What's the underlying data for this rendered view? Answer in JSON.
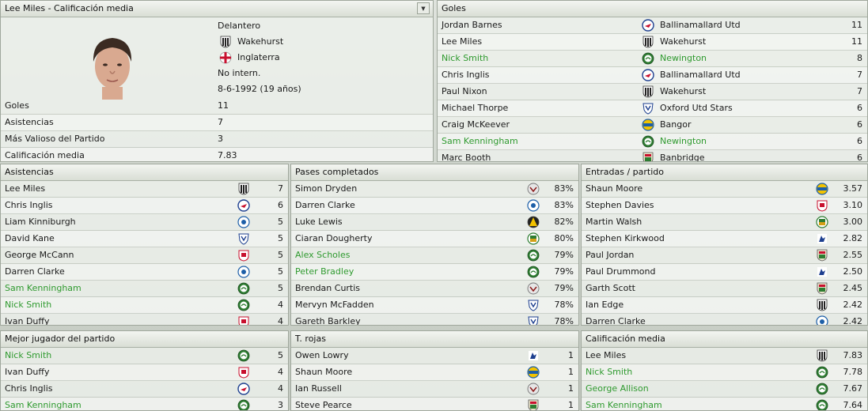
{
  "profile": {
    "title": "Lee Miles - Calificación media",
    "position": "Delantero",
    "club": "Wakehurst",
    "nation": "Inglaterra",
    "international": "No intern.",
    "dob": "8-6-1992 (19 años)",
    "stats": [
      {
        "label": "Goles",
        "value": "11"
      },
      {
        "label": "Asistencias",
        "value": "7"
      },
      {
        "label": "Más Valioso del Partido",
        "value": "3"
      },
      {
        "label": "Calificación media",
        "value": "7.83"
      }
    ]
  },
  "goals": {
    "title": "Goles",
    "rows": [
      {
        "name": "Jordan Barnes",
        "club": "Ballinamallard Utd",
        "value": "11",
        "hl": false,
        "badge": "ballinamallard"
      },
      {
        "name": "Lee Miles",
        "club": "Wakehurst",
        "value": "11",
        "hl": false,
        "badge": "wakehurst"
      },
      {
        "name": "Nick Smith",
        "club": "Newington",
        "value": "8",
        "hl": true,
        "badge": "newington"
      },
      {
        "name": "Chris Inglis",
        "club": "Ballinamallard Utd",
        "value": "7",
        "hl": false,
        "badge": "ballinamallard"
      },
      {
        "name": "Paul Nixon",
        "club": "Wakehurst",
        "value": "7",
        "hl": false,
        "badge": "wakehurst"
      },
      {
        "name": "Michael Thorpe",
        "club": "Oxford Utd Stars",
        "value": "6",
        "hl": false,
        "badge": "oxford"
      },
      {
        "name": "Craig McKeever",
        "club": "Bangor",
        "value": "6",
        "hl": false,
        "badge": "bangor"
      },
      {
        "name": "Sam Kenningham",
        "club": "Newington",
        "value": "6",
        "hl": true,
        "badge": "newington"
      },
      {
        "name": "Marc Booth",
        "club": "Banbridge",
        "value": "6",
        "hl": false,
        "badge": "banbridge"
      }
    ]
  },
  "assists": {
    "title": "Asistencias",
    "rows": [
      {
        "name": "Lee Miles",
        "value": "7",
        "hl": false,
        "badge": "wakehurst"
      },
      {
        "name": "Chris Inglis",
        "value": "6",
        "hl": false,
        "badge": "ballinamallard"
      },
      {
        "name": "Liam Kinniburgh",
        "value": "5",
        "hl": false,
        "badge": "bluewhite"
      },
      {
        "name": "David Kane",
        "value": "5",
        "hl": false,
        "badge": "oxford"
      },
      {
        "name": "George McCann",
        "value": "5",
        "hl": false,
        "badge": "redwhite"
      },
      {
        "name": "Darren Clarke",
        "value": "5",
        "hl": false,
        "badge": "bluewhite"
      },
      {
        "name": "Sam Kenningham",
        "value": "5",
        "hl": true,
        "badge": "newington"
      },
      {
        "name": "Nick Smith",
        "value": "4",
        "hl": true,
        "badge": "newington"
      },
      {
        "name": "Ivan Duffy",
        "value": "4",
        "hl": false,
        "badge": "redwhite"
      }
    ]
  },
  "passes": {
    "title": "Pases completados",
    "rows": [
      {
        "name": "Simon Dryden",
        "value": "83%",
        "hl": false,
        "badge": "greyswan"
      },
      {
        "name": "Darren Clarke",
        "value": "83%",
        "hl": false,
        "badge": "bluewhite"
      },
      {
        "name": "Luke Lewis",
        "value": "82%",
        "hl": false,
        "badge": "yellowblack"
      },
      {
        "name": "Ciaran Dougherty",
        "value": "80%",
        "hl": false,
        "badge": "greenmix"
      },
      {
        "name": "Alex Scholes",
        "value": "79%",
        "hl": true,
        "badge": "newington"
      },
      {
        "name": "Peter Bradley",
        "value": "79%",
        "hl": true,
        "badge": "newington"
      },
      {
        "name": "Brendan Curtis",
        "value": "79%",
        "hl": false,
        "badge": "greyswan"
      },
      {
        "name": "Mervyn McFadden",
        "value": "78%",
        "hl": false,
        "badge": "oxford"
      },
      {
        "name": "Gareth Barkley",
        "value": "78%",
        "hl": false,
        "badge": "oxford"
      }
    ]
  },
  "tackles": {
    "title": "Entradas / partido",
    "rows": [
      {
        "name": "Shaun Moore",
        "value": "3.57",
        "hl": false,
        "badge": "bangor"
      },
      {
        "name": "Stephen Davies",
        "value": "3.10",
        "hl": false,
        "badge": "redwhite"
      },
      {
        "name": "Martin Walsh",
        "value": "3.00",
        "hl": false,
        "badge": "greenmix"
      },
      {
        "name": "Stephen Kirkwood",
        "value": "2.82",
        "hl": false,
        "badge": "bluelion"
      },
      {
        "name": "Paul Jordan",
        "value": "2.55",
        "hl": false,
        "badge": "banbridge"
      },
      {
        "name": "Paul Drummond",
        "value": "2.50",
        "hl": false,
        "badge": "bluelion"
      },
      {
        "name": "Garth Scott",
        "value": "2.45",
        "hl": false,
        "badge": "banbridge"
      },
      {
        "name": "Ian Edge",
        "value": "2.42",
        "hl": false,
        "badge": "wakehurst"
      },
      {
        "name": "Darren Clarke",
        "value": "2.42",
        "hl": false,
        "badge": "bluewhite"
      }
    ]
  },
  "motm": {
    "title": "Mejor jugador del partido",
    "rows": [
      {
        "name": "Nick Smith",
        "value": "5",
        "hl": true,
        "badge": "newington"
      },
      {
        "name": "Ivan Duffy",
        "value": "4",
        "hl": false,
        "badge": "redwhite"
      },
      {
        "name": "Chris Inglis",
        "value": "4",
        "hl": false,
        "badge": "ballinamallard"
      },
      {
        "name": "Sam Kenningham",
        "value": "3",
        "hl": true,
        "badge": "newington"
      }
    ]
  },
  "redcards": {
    "title": "T. rojas",
    "rows": [
      {
        "name": "Owen Lowry",
        "value": "1",
        "hl": false,
        "badge": "bluelion"
      },
      {
        "name": "Shaun Moore",
        "value": "1",
        "hl": false,
        "badge": "bangor"
      },
      {
        "name": "Ian Russell",
        "value": "1",
        "hl": false,
        "badge": "greyswan"
      },
      {
        "name": "Steve Pearce",
        "value": "1",
        "hl": false,
        "badge": "banbridge"
      }
    ]
  },
  "avgrating": {
    "title": "Calificación media",
    "rows": [
      {
        "name": "Lee Miles",
        "value": "7.83",
        "hl": false,
        "badge": "wakehurst"
      },
      {
        "name": "Nick Smith",
        "value": "7.78",
        "hl": true,
        "badge": "newington"
      },
      {
        "name": "George Allison",
        "value": "7.67",
        "hl": true,
        "badge": "newington"
      },
      {
        "name": "Sam Kenningham",
        "value": "7.64",
        "hl": true,
        "badge": "newington"
      }
    ]
  },
  "colors": {
    "highlight": "#2f9a2f",
    "header": "#d9ded5"
  }
}
